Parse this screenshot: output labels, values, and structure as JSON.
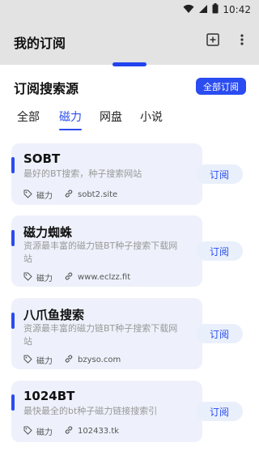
{
  "status": {
    "time": "10:42"
  },
  "header": {
    "title": "我的订阅"
  },
  "section": {
    "title": "订阅搜索源",
    "all_button": "全部订阅"
  },
  "tabs": [
    {
      "label": "全部"
    },
    {
      "label": "磁力"
    },
    {
      "label": "网盘"
    },
    {
      "label": "小说"
    }
  ],
  "active_tab": "磁力",
  "sources": [
    {
      "name": "SOBT",
      "desc": "最好的BT搜索，种子搜索网站",
      "tag": "磁力",
      "site": "sobt2.site",
      "button": "订阅"
    },
    {
      "name": "磁力蜘蛛",
      "desc": "资源最丰富的磁力链BT种子搜索下载网站",
      "tag": "磁力",
      "site": "www.eclzz.fit",
      "button": "订阅"
    },
    {
      "name": "八爪鱼搜索",
      "desc": "资源最丰富的磁力链BT种子搜索下载网站",
      "tag": "磁力",
      "site": "bzyso.com",
      "button": "订阅"
    },
    {
      "name": "1024BT",
      "desc": "最快最全的bt种子磁力链接搜索引",
      "tag": "磁力",
      "site": "102433.tk",
      "button": "订阅"
    }
  ],
  "colors": {
    "accent": "#2a4cf0",
    "card_bg": "#eef1fb",
    "appbar_bg": "#e3e3e3"
  }
}
